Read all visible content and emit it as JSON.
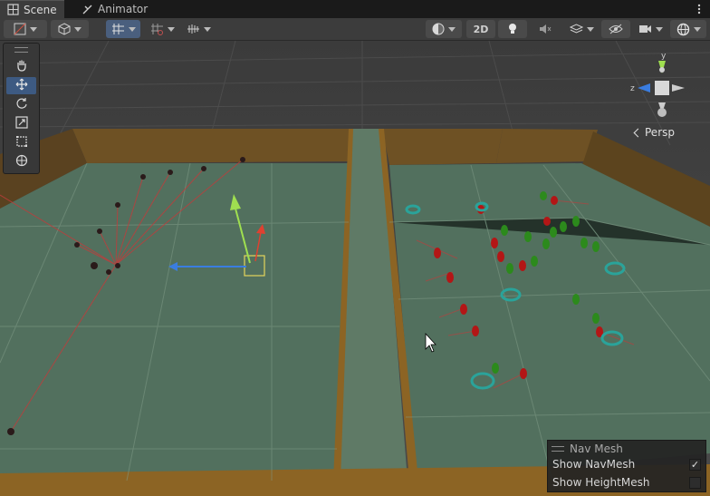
{
  "tabs": [
    {
      "label": "Scene",
      "icon": "scene-grid-icon",
      "active": true
    },
    {
      "label": "Animator",
      "icon": "animator-icon",
      "active": false
    }
  ],
  "toolbar": {
    "mode_2d_label": "2D"
  },
  "viewport": {
    "projection_label": "Persp",
    "gizmo_axes": {
      "y": "y",
      "z": "z"
    }
  },
  "nav_mesh_overlay": {
    "title": "Nav Mesh",
    "options": [
      {
        "label": "Show NavMesh",
        "checked": true
      },
      {
        "label": "Show HeightMesh",
        "checked": false
      }
    ]
  },
  "colors": {
    "ground": "#52705e",
    "wall": "#6e5124",
    "accent": "#3d5a82",
    "red_agent": "#b31616",
    "green_agent": "#2c8a1c",
    "ring": "#2aa39a"
  }
}
